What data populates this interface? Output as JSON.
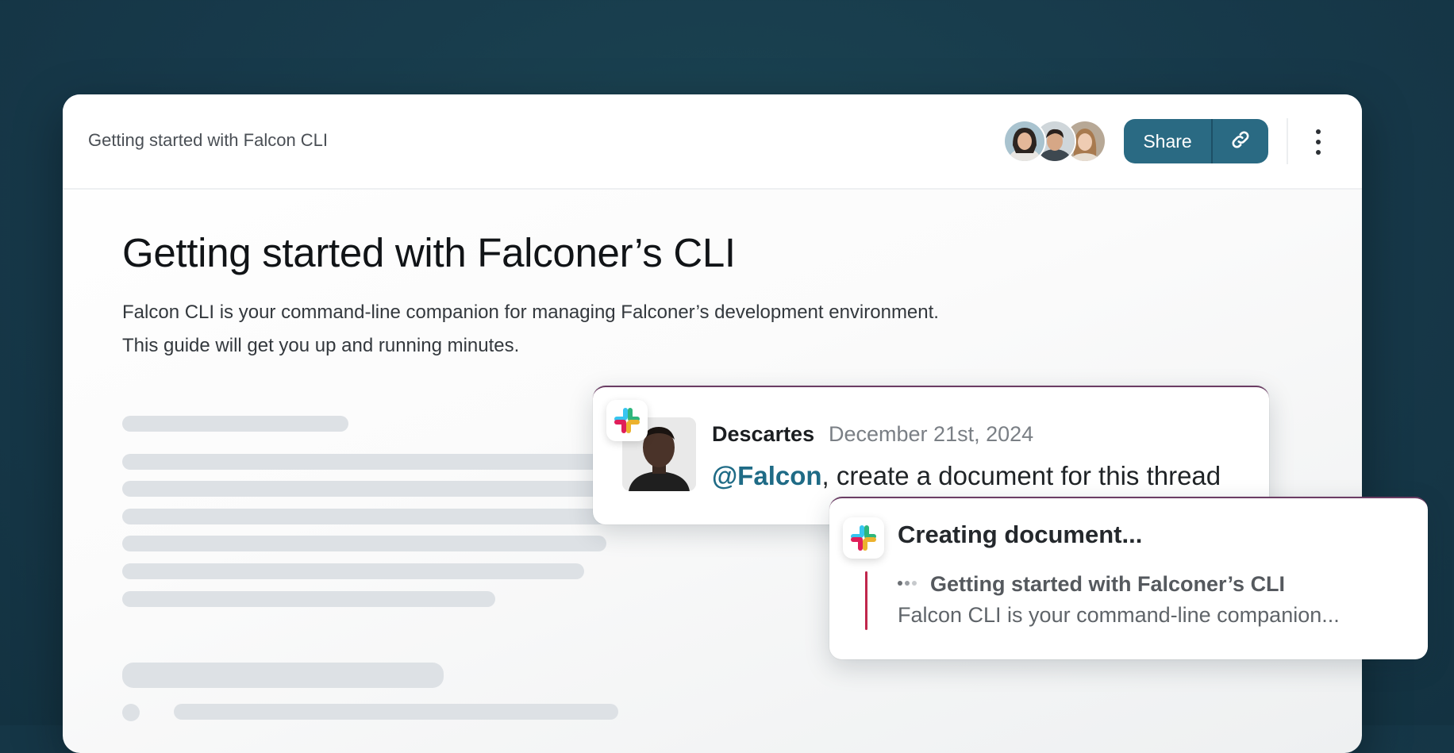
{
  "window": {
    "tab_title": "Getting started with Falcon CLI",
    "share_label": "Share",
    "collaborators": [
      "collaborator-1",
      "collaborator-2",
      "collaborator-3"
    ]
  },
  "document": {
    "title": "Getting started with Falconer’s CLI",
    "intro_line_1": "Falcon CLI is your command-line companion for managing Falconer’s development environment.",
    "intro_line_2": "This guide will get you up and running minutes."
  },
  "slack_message": {
    "author": "Descartes",
    "date": "December 21st, 2024",
    "mention": "@Falcon",
    "text": ", create a document for this thread"
  },
  "creating_card": {
    "status": "Creating document...",
    "doc_title": "Getting started with Falconer’s CLI",
    "doc_excerpt": "Falcon CLI is your command-line companion..."
  },
  "icons": {
    "slack": "slack-logo-icon",
    "link": "link-icon",
    "more": "more-vertical-icon"
  },
  "colors": {
    "accent": "#2a6a83",
    "mention": "#1f6b86",
    "quote_bar": "#c0264c",
    "background": "#17394a"
  }
}
